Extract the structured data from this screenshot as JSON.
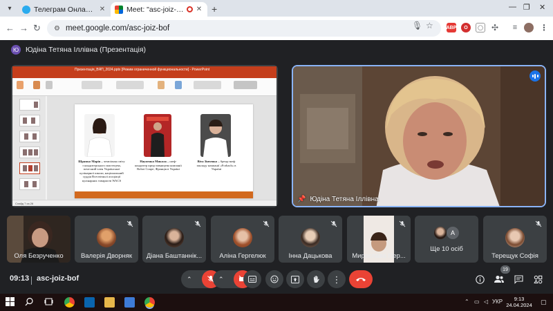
{
  "browser": {
    "tabs": [
      {
        "title": "Телеграм Онлайн (неофіційн",
        "active": false
      },
      {
        "title": "Meet: \"asc-joiz-bof\"",
        "active": true
      }
    ],
    "url": "meet.google.com/asc-joiz-bof"
  },
  "meeting": {
    "presenter_label": "Юдіна Тетяна Іллівна (Презентація)",
    "presenter_initial": "Ю",
    "main_speaker": "Юдіна Тетяна Іллівна",
    "time": "09:13",
    "code": "asc-joiz-bof",
    "people_count": "19"
  },
  "presentation": {
    "window_title": "Презентація_ВЯП_2024.pptx [Режим ограниченной функциональности] - PowerPoint",
    "status": "Слайд 7 из 26",
    "captions": [
      {
        "name": "Шрамко Марія –",
        "text": "чемпіонка світу з кондитерського мистецтва, почесний член Української кулінарної школи, національний суддія Всесвітньої асоціації кулінарних товариств WACS"
      },
      {
        "name": "Науменко Микола –",
        "text": "шеф-кондитер представництва компанії Robot Coupe, Франція в Україні"
      },
      {
        "name": "Віта Зінченко –",
        "text": "бренд-шеф закладу компанії «Forbach» в Україні"
      }
    ]
  },
  "participants": [
    {
      "name": "Оля Безрученко",
      "type": "video",
      "muted": false
    },
    {
      "name": "Валерія Дворняк",
      "type": "avatar",
      "muted": true
    },
    {
      "name": "Діана Баштаннік...",
      "type": "avatar",
      "muted": true
    },
    {
      "name": "Аліна Гергелюк",
      "type": "avatar",
      "muted": true
    },
    {
      "name": "Інна Дацькова",
      "type": "avatar",
      "muted": true
    },
    {
      "name": "Мирослава Пер...",
      "type": "video",
      "muted": true
    },
    {
      "name": "Ще 10 осіб",
      "type": "more",
      "muted": false,
      "more_initial": "А"
    },
    {
      "name": "Терещук Софія",
      "type": "avatar",
      "muted": true
    }
  ],
  "taskbar": {
    "lang": "УКР",
    "time": "9:13",
    "date": "24.04.2024"
  },
  "colors": {
    "meet_bg": "#202124",
    "tile_bg": "#3c4043",
    "end_call": "#ea4335",
    "accent_blue": "#1a73e8",
    "powerpoint": "#c43e1c"
  }
}
